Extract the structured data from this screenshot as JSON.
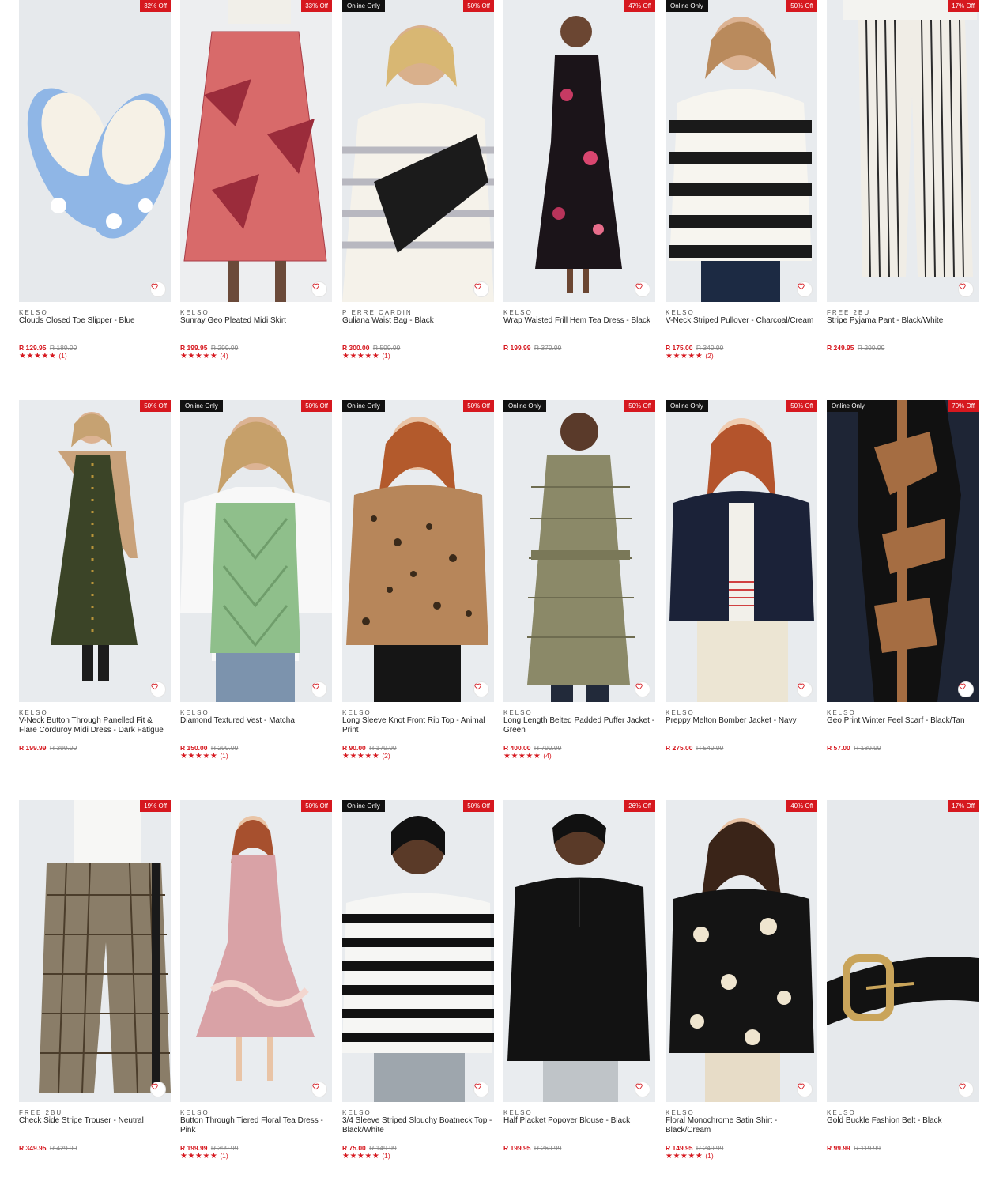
{
  "colors": {
    "sale_red": "#d6181f",
    "badge_black": "#111111",
    "image_bg": "#e9edf0"
  },
  "icons": {
    "wishlist": "heart-outline-icon",
    "rating": "star-icon"
  },
  "products": [
    {
      "brand": "KELSO",
      "title": "Clouds Closed Toe Slipper - Blue",
      "price": "R 129.95",
      "was": "R 189.99",
      "discount": "32% Off",
      "online_only": "",
      "stars": "★★★★★",
      "reviews": "(1)",
      "rating_value": 5,
      "image": "slippers"
    },
    {
      "brand": "KELSO",
      "title": "Sunray Geo Pleated Midi Skirt",
      "price": "R 199.95",
      "was": "R 299.99",
      "discount": "33% Off",
      "online_only": "",
      "stars": "★★★★★",
      "reviews": "(4)",
      "rating_value": 5,
      "image": "skirt"
    },
    {
      "brand": "PIERRE CARDIN",
      "title": "Guliana Waist Bag - Black",
      "price": "R 300.00",
      "was": "R 599.99",
      "discount": "50% Off",
      "online_only": "Online Only",
      "stars": "★★★★★",
      "reviews": "(1)",
      "rating_value": 5,
      "image": "waistbag"
    },
    {
      "brand": "KELSO",
      "title": "Wrap Waisted Frill Hem Tea Dress - Black",
      "price": "R 199.99",
      "was": "R 379.99",
      "discount": "47% Off",
      "online_only": "",
      "stars": "",
      "reviews": "",
      "rating_value": 0,
      "image": "floraldress"
    },
    {
      "brand": "KELSO",
      "title": "V-Neck Striped Pullover - Charcoal/Cream",
      "price": "R 175.00",
      "was": "R 349.99",
      "discount": "50% Off",
      "online_only": "Online Only",
      "stars": "★★★★★",
      "reviews": "(2)",
      "rating_value": 5,
      "image": "stripedpullover"
    },
    {
      "brand": "FREE 2BU",
      "title": "Stripe Pyjama Pant - Black/White",
      "price": "R 249.95",
      "was": "R 299.99",
      "discount": "17% Off",
      "online_only": "",
      "stars": "",
      "reviews": "",
      "rating_value": 0,
      "image": "pyjamapant"
    },
    {
      "brand": "KELSO",
      "title": "V-Neck Button Through Panelled Fit & Flare Corduroy Midi Dress - Dark Fatigue",
      "price": "R 199.99",
      "was": "R 399.99",
      "discount": "50% Off",
      "online_only": "",
      "stars": "",
      "reviews": "",
      "rating_value": 0,
      "image": "corduroydress"
    },
    {
      "brand": "KELSO",
      "title": "Diamond Textured Vest - Matcha",
      "price": "R 150.00",
      "was": "R 299.99",
      "discount": "50% Off",
      "online_only": "Online Only",
      "stars": "★★★★★",
      "reviews": "(1)",
      "rating_value": 5,
      "image": "vest"
    },
    {
      "brand": "KELSO",
      "title": "Long Sleeve Knot Front Rib Top - Animal Print",
      "price": "R 90.00",
      "was": "R 179.99",
      "discount": "50% Off",
      "online_only": "Online Only",
      "stars": "★★★★★",
      "reviews": "(2)",
      "rating_value": 5,
      "image": "animaltop"
    },
    {
      "brand": "KELSO",
      "title": "Long Length Belted Padded Puffer Jacket - Green",
      "price": "R 400.00",
      "was": "R 799.99",
      "discount": "50% Off",
      "online_only": "Online Only",
      "stars": "★★★★★",
      "reviews": "(4)",
      "rating_value": 5,
      "image": "puffer"
    },
    {
      "brand": "KELSO",
      "title": "Preppy Melton Bomber Jacket - Navy",
      "price": "R 275.00",
      "was": "R 549.99",
      "discount": "50% Off",
      "online_only": "Online Only",
      "stars": "",
      "reviews": "",
      "rating_value": 0,
      "image": "bomber"
    },
    {
      "brand": "KELSO",
      "title": "Geo Print Winter Feel Scarf - Black/Tan",
      "price": "R 57.00",
      "was": "R 189.99",
      "discount": "70% Off",
      "online_only": "Online Only",
      "stars": "",
      "reviews": "",
      "rating_value": 0,
      "image": "scarf"
    },
    {
      "brand": "FREE 2BU",
      "title": "Check Side Stripe Trouser - Neutral",
      "price": "R 349.95",
      "was": "R 429.99",
      "discount": "19% Off",
      "online_only": "",
      "stars": "",
      "reviews": "",
      "rating_value": 0,
      "image": "checktrouser"
    },
    {
      "brand": "KELSO",
      "title": "Button Through Tiered Floral Tea Dress - Pink",
      "price": "R 199.99",
      "was": "R 399.99",
      "discount": "50% Off",
      "online_only": "",
      "stars": "★★★★★",
      "reviews": "(1)",
      "rating_value": 5,
      "image": "pinkdress"
    },
    {
      "brand": "KELSO",
      "title": "3/4 Sleeve Striped Slouchy Boatneck Top - Black/White",
      "price": "R 75.00",
      "was": "R 149.99",
      "discount": "50% Off",
      "online_only": "Online Only",
      "stars": "★★★★★",
      "reviews": "(1)",
      "rating_value": 5,
      "image": "boatneck"
    },
    {
      "brand": "KELSO",
      "title": "Half Placket Popover Blouse - Black",
      "price": "R 199.95",
      "was": "R 269.99",
      "discount": "26% Off",
      "online_only": "",
      "stars": "",
      "reviews": "",
      "rating_value": 0,
      "image": "blouse"
    },
    {
      "brand": "KELSO",
      "title": "Floral Monochrome Satin Shirt - Black/Cream",
      "price": "R 149.95",
      "was": "R 249.99",
      "discount": "40% Off",
      "online_only": "",
      "stars": "★★★★★",
      "reviews": "(1)",
      "rating_value": 5,
      "image": "satinshirt"
    },
    {
      "brand": "KELSO",
      "title": "Gold Buckle Fashion Belt - Black",
      "price": "R 99.99",
      "was": "R 119.99",
      "discount": "17% Off",
      "online_only": "",
      "stars": "",
      "reviews": "",
      "rating_value": 0,
      "image": "belt"
    }
  ]
}
